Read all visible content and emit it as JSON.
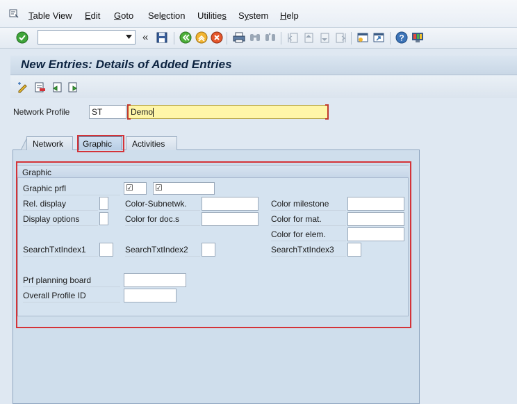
{
  "menubar": {
    "items": [
      {
        "label": "Table View",
        "ul": "T",
        "rest": "able View"
      },
      {
        "label": "Edit",
        "ul": "E",
        "rest": "dit"
      },
      {
        "label": "Goto",
        "ul": "G",
        "rest": "oto"
      },
      {
        "label": "Selection",
        "pre": "Sel",
        "ul": "e",
        "rest": "ction"
      },
      {
        "label": "Utilities",
        "pre": "Utilitie",
        "ul": "s",
        "rest": ""
      },
      {
        "label": "System",
        "pre": "S",
        "ul": "y",
        "rest": "stem"
      },
      {
        "label": "Help",
        "ul": "H",
        "rest": "elp"
      }
    ]
  },
  "toolbar": {
    "command_field_value": "",
    "icons": [
      "enter-icon",
      "back-icon",
      "exit-icon",
      "cancel-icon",
      "print-icon",
      "find-icon",
      "find-next-icon",
      "first-page-icon",
      "previous-page-icon",
      "next-page-icon",
      "last-page-icon",
      "create-session-icon",
      "shortcut-icon",
      "help-icon",
      "customize-layout-icon"
    ]
  },
  "title": "New Entries: Details of Added Entries",
  "header": {
    "network_profile_label": "Network Profile",
    "network_profile_value": "ST",
    "network_profile_desc": "Demo"
  },
  "tabs": [
    {
      "label": "Network",
      "active": false
    },
    {
      "label": "Graphic",
      "active": true
    },
    {
      "label": "Activities",
      "active": false
    }
  ],
  "group": {
    "title": "Graphic",
    "graphic_prfl_label": "Graphic prfl",
    "rel_display_label": "Rel. display",
    "display_options_label": "Display options",
    "color_subnetwk_label": "Color-Subnetwk.",
    "color_doc_label": "Color for doc.s",
    "color_milestone_label": "Color milestone",
    "color_mat_label": "Color for mat.",
    "color_elem_label": "Color for elem.",
    "search1_label": "SearchTxtIndex1",
    "search2_label": "SearchTxtIndex2",
    "search3_label": "SearchTxtIndex3",
    "prf_planning_label": "Prf planning board",
    "overall_profile_label": "Overall Profile ID",
    "check_glyph": "☑"
  }
}
